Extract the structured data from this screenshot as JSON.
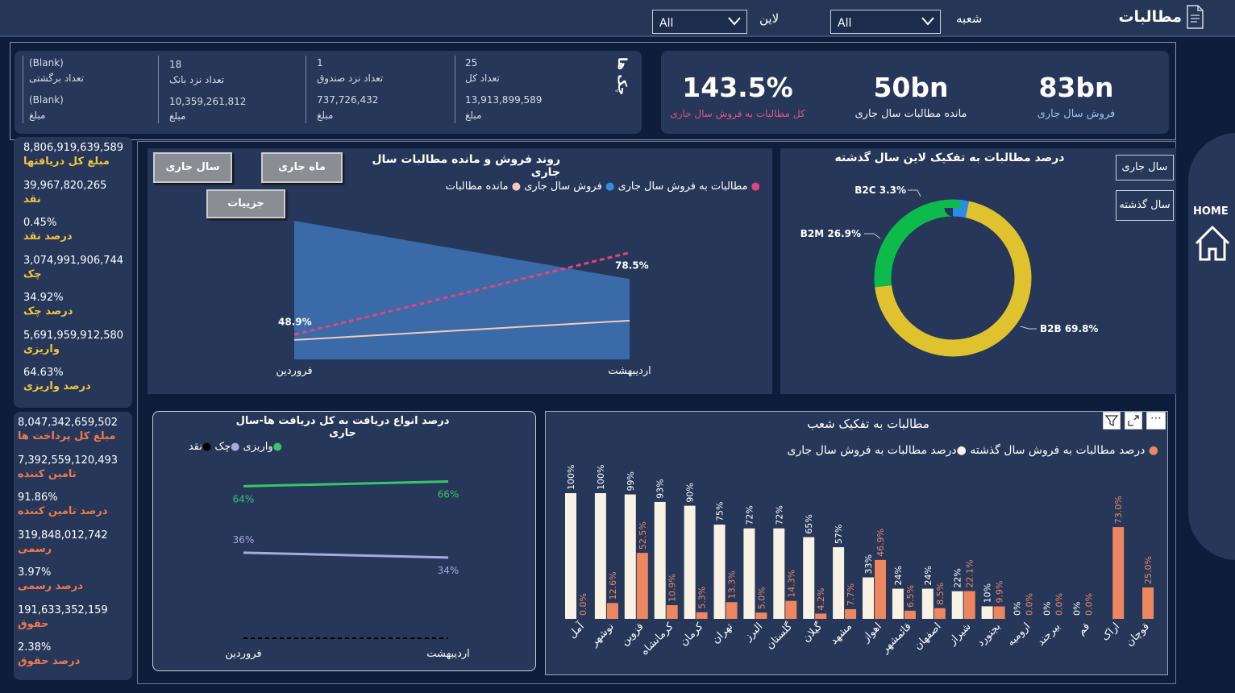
{
  "header": {
    "title": "مطالبات",
    "branch_label": "شعبه",
    "branch_value": "All",
    "line_label": "لاین",
    "line_value": "All"
  },
  "kpis": [
    {
      "value": "83bn",
      "label": "فروش سال جاری",
      "color": "#9bc4f0"
    },
    {
      "value": "50bn",
      "label": "مانده مطالبات سال جاری",
      "color": "#f2f2f2"
    },
    {
      "value": "143.5%",
      "label": "کل مطالبات به فروش سال جاری",
      "color": "#e0558a"
    }
  ],
  "cheques": {
    "title": "چک ها",
    "items": [
      {
        "top": "25",
        "label": "تعداد کل",
        "amount": "13,913,899,589",
        "amount_label": "مبلغ"
      },
      {
        "top": "1",
        "label": "تعداد نزد صندوق",
        "amount": "737,726,432",
        "amount_label": "مبلغ"
      },
      {
        "top": "18",
        "label": "تعداد نزد بانک",
        "amount": "10,359,261,812",
        "amount_label": "مبلغ"
      },
      {
        "top": "(Blank)",
        "label": "تعداد برگشتی",
        "amount": "(Blank)",
        "amount_label": "مبلغ"
      }
    ]
  },
  "receipts": [
    {
      "value": "8,806,919,639,589",
      "label": "مبلغ کل دریافتها"
    },
    {
      "value": "39,967,820,265",
      "label": "نقد"
    },
    {
      "value": "0.45%",
      "label": "درصد نقد"
    },
    {
      "value": "3,074,991,906,744",
      "label": "چک"
    },
    {
      "value": "34.92%",
      "label": "درصد چک"
    },
    {
      "value": "5,691,959,912,580",
      "label": "واریزی"
    },
    {
      "value": "64.63%",
      "label": "درصد واریزی"
    }
  ],
  "payments": [
    {
      "value": "8,047,342,659,502",
      "label": "مبلغ کل پرداخت ها"
    },
    {
      "value": "7,392,559,120,493",
      "label": "تامین کننده"
    },
    {
      "value": "91.86%",
      "label": "درصد تامین کننده"
    },
    {
      "value": "319,848,012,742",
      "label": "رسمی"
    },
    {
      "value": "3.97%",
      "label": "درصد رسمی"
    },
    {
      "value": "191,633,352,159",
      "label": "حقوق"
    },
    {
      "value": "2.38%",
      "label": "درصد حقوق"
    }
  ],
  "buttons": {
    "current_year": "سال جاری",
    "current_month": "ماه جاری",
    "details": "جزییات",
    "side_current": "سال جاری",
    "side_last": "سال گذشته",
    "home": "HOME"
  },
  "trend": {
    "title": "روند فروش و مانده مطالبات سال جاری",
    "legend": [
      {
        "label": "مطالبات به فروش سال جاری",
        "color": "#e0457a"
      },
      {
        "label": "فروش سال جاری",
        "color": "#2f8fe0"
      },
      {
        "label": "مانده مطالبات",
        "color": "#f6c9b8"
      }
    ]
  },
  "receipt_types": {
    "title": "درصد انواع دریافت به کل دریافت ها-سال جاری",
    "legend": [
      {
        "label": "واریزی",
        "color": "#34c76a"
      },
      {
        "label": "چک",
        "color": "#a9a9e0"
      },
      {
        "label": "نقد",
        "color": "#000000"
      }
    ]
  },
  "donut": {
    "title": "درصد مطالبات به تفکیک لاین سال گذشته"
  },
  "branches": {
    "title": "مطالبات به تفکیک شعب",
    "legend": [
      {
        "label": "درصد مطالبات به فروش سال گذشته",
        "color": "#ee8760"
      },
      {
        "label": "درصد مطالبات به فروش سال جاری",
        "color": "#f7f2e4"
      }
    ]
  },
  "chart_data": [
    {
      "type": "area",
      "title": "روند فروش و مانده مطالبات سال جاری",
      "categories": [
        "فروردین",
        "اردیبهشت"
      ],
      "series": [
        {
          "name": "فروش سال جاری",
          "kind": "area",
          "values": [
            100,
            58
          ]
        },
        {
          "name": "مانده مطالبات",
          "kind": "line",
          "values": [
            14,
            28
          ]
        },
        {
          "name": "مطالبات به فروش سال جاری",
          "kind": "dashed-line",
          "values": [
            48.9,
            78.5
          ],
          "labels": [
            "48.9%",
            "78.5%"
          ]
        }
      ]
    },
    {
      "type": "line",
      "title": "درصد انواع دریافت به کل دریافت ها-سال جاری",
      "categories": [
        "فروردین",
        "اردیبهشت"
      ],
      "series": [
        {
          "name": "واریزی",
          "values": [
            64,
            66
          ],
          "labels": [
            "64%",
            "66%"
          ]
        },
        {
          "name": "چک",
          "values": [
            36,
            34
          ],
          "labels": [
            "36%",
            "34%"
          ]
        },
        {
          "name": "نقد",
          "values": [
            0,
            0
          ]
        }
      ]
    },
    {
      "type": "pie",
      "title": "درصد مطالبات به تفکیک لاین سال گذشته",
      "slices": [
        {
          "label": "B2B",
          "value": 69.8,
          "color": "#e0c22f",
          "text": "B2B 69.8%"
        },
        {
          "label": "B2M",
          "value": 26.9,
          "color": "#0dbb4a",
          "text": "B2M 26.9%"
        },
        {
          "label": "B2C",
          "value": 3.3,
          "color": "#2a8de8",
          "text": "B2C 3.3%"
        }
      ]
    },
    {
      "type": "bar",
      "title": "مطالبات به تفکیک شعب",
      "categories": [
        "آمل",
        "نوشهر",
        "قزوین",
        "کرمانشاه",
        "کرمان",
        "تهران",
        "البرز",
        "گلستان",
        "گیلان",
        "مشهد",
        "اهواز",
        "قائمشهر",
        "اصفهان",
        "شیراز",
        "بجنورد",
        "ارومیه",
        "بیرجند",
        "قم",
        "اراک",
        "قوچان"
      ],
      "series": [
        {
          "name": "درصد مطالبات به فروش سال جاری",
          "values": [
            100,
            100,
            99,
            93,
            90,
            75,
            72,
            72,
            65,
            57,
            33,
            24,
            24,
            22,
            10,
            0,
            0,
            0,
            null,
            null
          ],
          "labels": [
            "100%",
            "100%",
            "99%",
            "93%",
            "90%",
            "75%",
            "72%",
            "72%",
            "65%",
            "57%",
            "33%",
            "24%",
            "24%",
            "22%",
            "10%",
            "0%",
            "0%",
            "0%",
            "",
            ""
          ]
        },
        {
          "name": "درصد مطالبات به فروش سال گذشته",
          "values": [
            0,
            12.6,
            52.5,
            10.9,
            5.3,
            13.3,
            5.0,
            14.3,
            4.2,
            7.7,
            46.9,
            6.5,
            8.5,
            22.1,
            9.9,
            0,
            0,
            0,
            73.0,
            25.0
          ],
          "labels": [
            "0.0%",
            "12.6%",
            "52.5%",
            "10.9%",
            "5.3%",
            "13.3%",
            "5.0%",
            "14.3%",
            "4.2%",
            "7.7%",
            "46.9%",
            "6.5%",
            "8.5%",
            "22.1%",
            "9.9%",
            "0.0%",
            "0.0%",
            "0.0%",
            "73.0%",
            "25.0%"
          ]
        }
      ]
    }
  ]
}
